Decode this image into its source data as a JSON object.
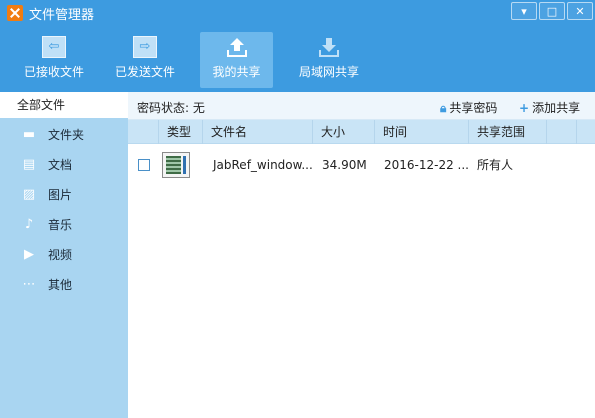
{
  "window": {
    "title": "文件管理器",
    "controls": {
      "menu": "▾",
      "maximize": "□",
      "close": "✕"
    }
  },
  "toolbar": {
    "buttons": [
      {
        "label": "已接收文件",
        "icon": "folder-receive-icon",
        "active": false
      },
      {
        "label": "已发送文件",
        "icon": "folder-send-icon",
        "active": false
      },
      {
        "label": "我的共享",
        "icon": "upload-share-icon",
        "active": true
      },
      {
        "label": "局域网共享",
        "icon": "download-lan-icon",
        "active": false
      }
    ]
  },
  "sidebar": {
    "all_files": "全部文件",
    "items": [
      {
        "label": "文件夹",
        "icon": "folder-icon",
        "glyph": "▬"
      },
      {
        "label": "文档",
        "icon": "document-icon",
        "glyph": "▤"
      },
      {
        "label": "图片",
        "icon": "picture-icon",
        "glyph": "▨"
      },
      {
        "label": "音乐",
        "icon": "music-icon",
        "glyph": "♪"
      },
      {
        "label": "视频",
        "icon": "video-icon",
        "glyph": "▶"
      },
      {
        "label": "其他",
        "icon": "more-icon",
        "glyph": "⋯"
      }
    ]
  },
  "main": {
    "password_status": "密码状态: 无",
    "share_password": "共享密码",
    "add_share": "添加共享",
    "columns": [
      "类型",
      "文件名",
      "大小",
      "时间",
      "共享范围"
    ],
    "rows": [
      {
        "type_icon": "file-thumbnail-icon",
        "name": "JabRef_window...",
        "size": "34.90M",
        "time": "2016-12-22 ...",
        "scope": "所有人"
      }
    ]
  },
  "colors": {
    "accent": "#3d9be0",
    "sidebar_bg": "#a9d5f1",
    "header_bg": "#c9e4f6",
    "logo": "#f07c12"
  }
}
